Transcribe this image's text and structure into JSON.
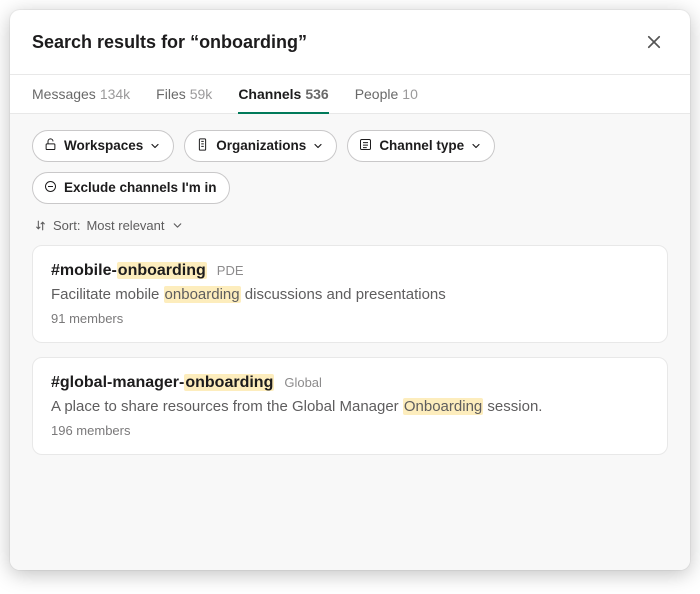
{
  "header": {
    "title": "Search results for “onboarding”"
  },
  "highlight_term": "onboarding",
  "tabs": [
    {
      "label": "Messages",
      "count": "134k",
      "active": false
    },
    {
      "label": "Files",
      "count": "59k",
      "active": false
    },
    {
      "label": "Channels",
      "count": "536",
      "active": true
    },
    {
      "label": "People",
      "count": "10",
      "active": false
    }
  ],
  "filters": [
    {
      "icon": "workspaces-icon",
      "label": "Workspaces",
      "has_chevron": true
    },
    {
      "icon": "organizations-icon",
      "label": "Organizations",
      "has_chevron": true
    },
    {
      "icon": "channel-type-icon",
      "label": "Channel type",
      "has_chevron": true
    },
    {
      "icon": "exclude-icon",
      "label": "Exclude channels I'm in",
      "has_chevron": false
    }
  ],
  "sort": {
    "prefix": "Sort:",
    "value": "Most relevant"
  },
  "results": [
    {
      "name": "#mobile-onboarding",
      "suffix": "PDE",
      "description": "Facilitate mobile onboarding discussions and presentations",
      "members": "91 members"
    },
    {
      "name": "#global-manager-onboarding",
      "suffix": "Global",
      "description": "A place to share resources from the Global Manager Onboarding session.",
      "members": "196 members"
    }
  ],
  "icons": {
    "workspaces-icon": "workspaces",
    "organizations-icon": "building",
    "channel-type-icon": "list",
    "exclude-icon": "minus-circle",
    "sort-icon": "sort-arrows",
    "chevron-down-icon": "chevron-down",
    "close-icon": "x"
  }
}
